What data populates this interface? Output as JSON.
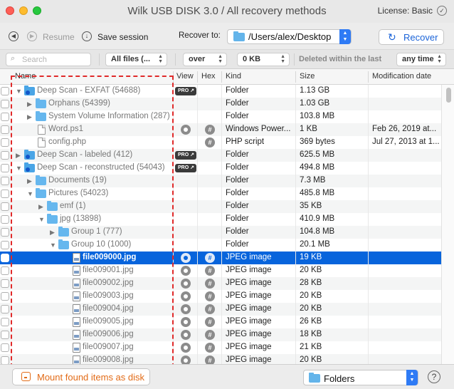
{
  "window": {
    "title": "Wilk USB DISK 3.0 / All recovery methods",
    "license": "License: Basic"
  },
  "toolbar": {
    "resume_label": "Resume",
    "save_session_label": "Save session",
    "recover_to_label": "Recover to:",
    "recover_path": "/Users/alex/Desktop",
    "recover_button": "Recover"
  },
  "filters": {
    "search_placeholder": "Search",
    "file_type": "All files (...",
    "size_op": "over",
    "size_value": "0 KB",
    "deleted_label": "Deleted within the last",
    "time_range": "any time"
  },
  "columns": {
    "name": "Name",
    "view": "View",
    "hex": "Hex",
    "kind": "Kind",
    "size": "Size",
    "modified": "Modification date"
  },
  "rows": [
    {
      "name": "Deep Scan - EXFAT (54688)",
      "kind": "Folder",
      "size": "1.13 GB",
      "date": ""
    },
    {
      "name": "Orphans (54399)",
      "kind": "Folder",
      "size": "1.03 GB",
      "date": ""
    },
    {
      "name": "System Volume Information (287)",
      "kind": "Folder",
      "size": "103.8 MB",
      "date": ""
    },
    {
      "name": "Word.ps1",
      "kind": "Windows Power...",
      "size": "1 KB",
      "date": "Feb 26, 2019 at..."
    },
    {
      "name": "config.php",
      "kind": "PHP script",
      "size": "369 bytes",
      "date": "Jul 27, 2013 at 1..."
    },
    {
      "name": "Deep Scan - labeled (412)",
      "kind": "Folder",
      "size": "625.5 MB",
      "date": ""
    },
    {
      "name": "Deep Scan - reconstructed (54043)",
      "kind": "Folder",
      "size": "494.8 MB",
      "date": ""
    },
    {
      "name": "Documents (19)",
      "kind": "Folder",
      "size": "7.3 MB",
      "date": ""
    },
    {
      "name": "Pictures (54023)",
      "kind": "Folder",
      "size": "485.8 MB",
      "date": ""
    },
    {
      "name": "emf (1)",
      "kind": "Folder",
      "size": "35 KB",
      "date": ""
    },
    {
      "name": "jpg (13898)",
      "kind": "Folder",
      "size": "410.9 MB",
      "date": ""
    },
    {
      "name": "Group 1 (777)",
      "kind": "Folder",
      "size": "104.8 MB",
      "date": ""
    },
    {
      "name": "Group 10 (1000)",
      "kind": "Folder",
      "size": "20.1 MB",
      "date": ""
    },
    {
      "name": "file009000.jpg",
      "kind": "JPEG image",
      "size": "19 KB",
      "date": ""
    },
    {
      "name": "file009001.jpg",
      "kind": "JPEG image",
      "size": "20 KB",
      "date": ""
    },
    {
      "name": "file009002.jpg",
      "kind": "JPEG image",
      "size": "28 KB",
      "date": ""
    },
    {
      "name": "file009003.jpg",
      "kind": "JPEG image",
      "size": "20 KB",
      "date": ""
    },
    {
      "name": "file009004.jpg",
      "kind": "JPEG image",
      "size": "20 KB",
      "date": ""
    },
    {
      "name": "file009005.jpg",
      "kind": "JPEG image",
      "size": "26 KB",
      "date": ""
    },
    {
      "name": "file009006.jpg",
      "kind": "JPEG image",
      "size": "18 KB",
      "date": ""
    },
    {
      "name": "file009007.jpg",
      "kind": "JPEG image",
      "size": "21 KB",
      "date": ""
    },
    {
      "name": "file009008.jpg",
      "kind": "JPEG image",
      "size": "20 KB",
      "date": ""
    }
  ],
  "pro_badge": "PRO",
  "bottom": {
    "mount_button": "Mount found items as disk",
    "view_mode": "Folders",
    "help": "?"
  },
  "colors": {
    "selection": "#0764dc",
    "accent": "#1a63d8",
    "highlight_dash": "#e02a2a",
    "mount_orange": "#e26b17"
  }
}
